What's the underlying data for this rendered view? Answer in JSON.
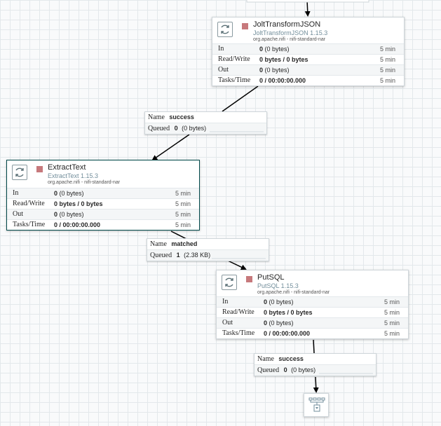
{
  "processors": [
    {
      "id": "jolt",
      "name": "JoltTransformJSON",
      "type": "JoltTransformJSON 1.15.3",
      "bundle": "org.apache.nifi - nifi-standard-nar",
      "status_color": "#c7797c",
      "stats": {
        "in": {
          "label": "In",
          "count": "0",
          "detail": "(0 bytes)",
          "window": "5 min"
        },
        "rw": {
          "label": "Read/Write",
          "value": "0 bytes / 0 bytes",
          "window": "5 min"
        },
        "out": {
          "label": "Out",
          "count": "0",
          "detail": "(0 bytes)",
          "window": "5 min"
        },
        "tasks": {
          "label": "Tasks/Time",
          "value": "0 / 00:00:00.000",
          "window": "5 min"
        }
      }
    },
    {
      "id": "extract",
      "name": "ExtractText",
      "type": "ExtractText 1.15.3",
      "bundle": "org.apache.nifi - nifi-standard-nar",
      "status_color": "#c7797c",
      "stats": {
        "in": {
          "label": "In",
          "count": "0",
          "detail": "(0 bytes)",
          "window": "5 min"
        },
        "rw": {
          "label": "Read/Write",
          "value": "0 bytes / 0 bytes",
          "window": "5 min"
        },
        "out": {
          "label": "Out",
          "count": "0",
          "detail": "(0 bytes)",
          "window": "5 min"
        },
        "tasks": {
          "label": "Tasks/Time",
          "value": "0 / 00:00:00.000",
          "window": "5 min"
        }
      }
    },
    {
      "id": "putsql",
      "name": "PutSQL",
      "type": "PutSQL 1.15.3",
      "bundle": "org.apache.nifi - nifi-standard-nar",
      "status_color": "#c7797c",
      "stats": {
        "in": {
          "label": "In",
          "count": "0",
          "detail": "(0 bytes)",
          "window": "5 min"
        },
        "rw": {
          "label": "Read/Write",
          "value": "0 bytes / 0 bytes",
          "window": "5 min"
        },
        "out": {
          "label": "Out",
          "count": "0",
          "detail": "(0 bytes)",
          "window": "5 min"
        },
        "tasks": {
          "label": "Tasks/Time",
          "value": "0 / 00:00:00.000",
          "window": "5 min"
        }
      }
    }
  ],
  "connections": [
    {
      "name_key": "Name",
      "name": "success",
      "queued_key": "Queued",
      "queued_count": "0",
      "queued_size": "(0 bytes)"
    },
    {
      "name_key": "Name",
      "name": "matched",
      "queued_key": "Queued",
      "queued_count": "1",
      "queued_size": "(2.38 KB)"
    },
    {
      "name_key": "Name",
      "name": "success",
      "queued_key": "Queued",
      "queued_count": "0",
      "queued_size": "(0 bytes)"
    }
  ],
  "icons": {
    "processor": "processor-icon",
    "funnel": "funnel-icon"
  },
  "colors": {
    "canvas": "#f9fafb",
    "grid": "#e3e8eb",
    "stopped": "#c7797c",
    "selected_border": "#004849",
    "type_text": "#728e9b"
  }
}
